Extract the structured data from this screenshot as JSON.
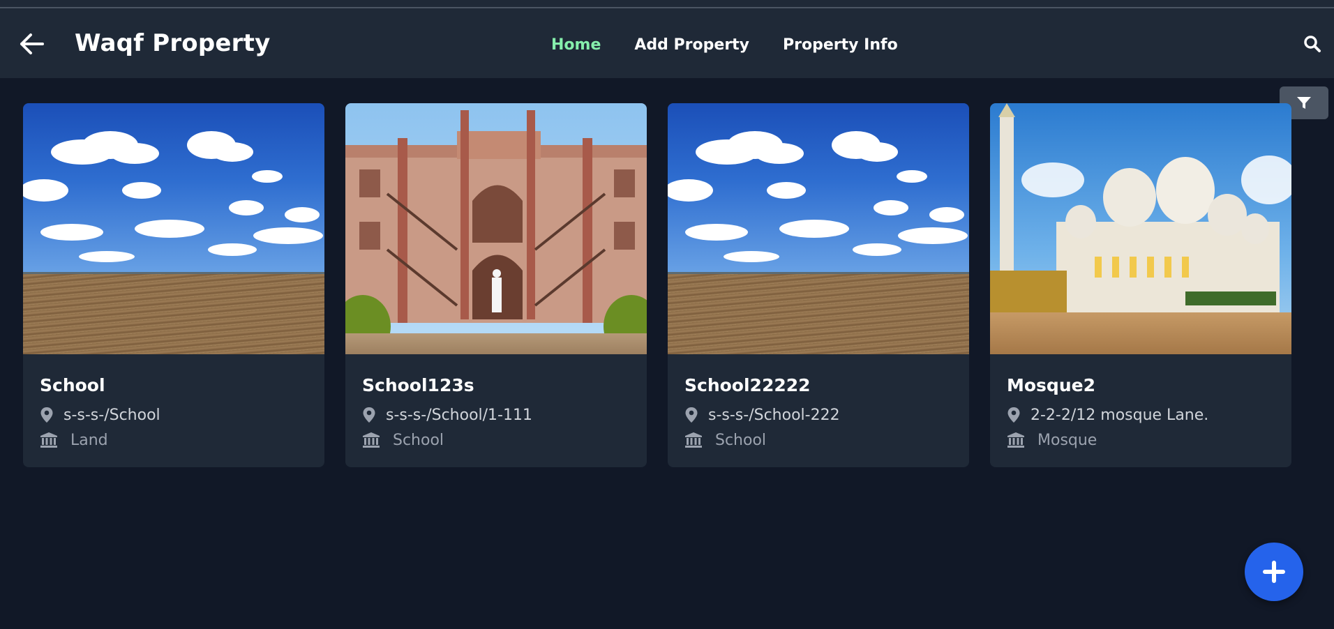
{
  "header": {
    "title": "Waqf Property",
    "nav": [
      {
        "label": "Home",
        "active": true
      },
      {
        "label": "Add Property",
        "active": false
      },
      {
        "label": "Property Info",
        "active": false
      }
    ]
  },
  "cards": [
    {
      "title": "School",
      "address": "s-s-s-/School",
      "type": "Land",
      "image": "sky-and-field"
    },
    {
      "title": "School123s",
      "address": "s-s-s-/School/1-111",
      "type": "School",
      "image": "school-building"
    },
    {
      "title": "School22222",
      "address": "s-s-s-/School-222",
      "type": "School",
      "image": "sky-and-field"
    },
    {
      "title": "Mosque2",
      "address": "2-2-2/12 mosque Lane.",
      "type": "Mosque",
      "image": "mosque"
    }
  ],
  "icons": {
    "back": "arrow-left-icon",
    "search": "search-icon",
    "filter": "filter-icon",
    "location": "map-pin-icon",
    "type": "landmark-icon",
    "add": "plus-icon"
  },
  "colors": {
    "background": "#111827",
    "header": "#1f2937",
    "card": "#1f2937",
    "nav_active": "#86efac",
    "fab": "#2563eb",
    "filter_button": "#4b5563"
  }
}
